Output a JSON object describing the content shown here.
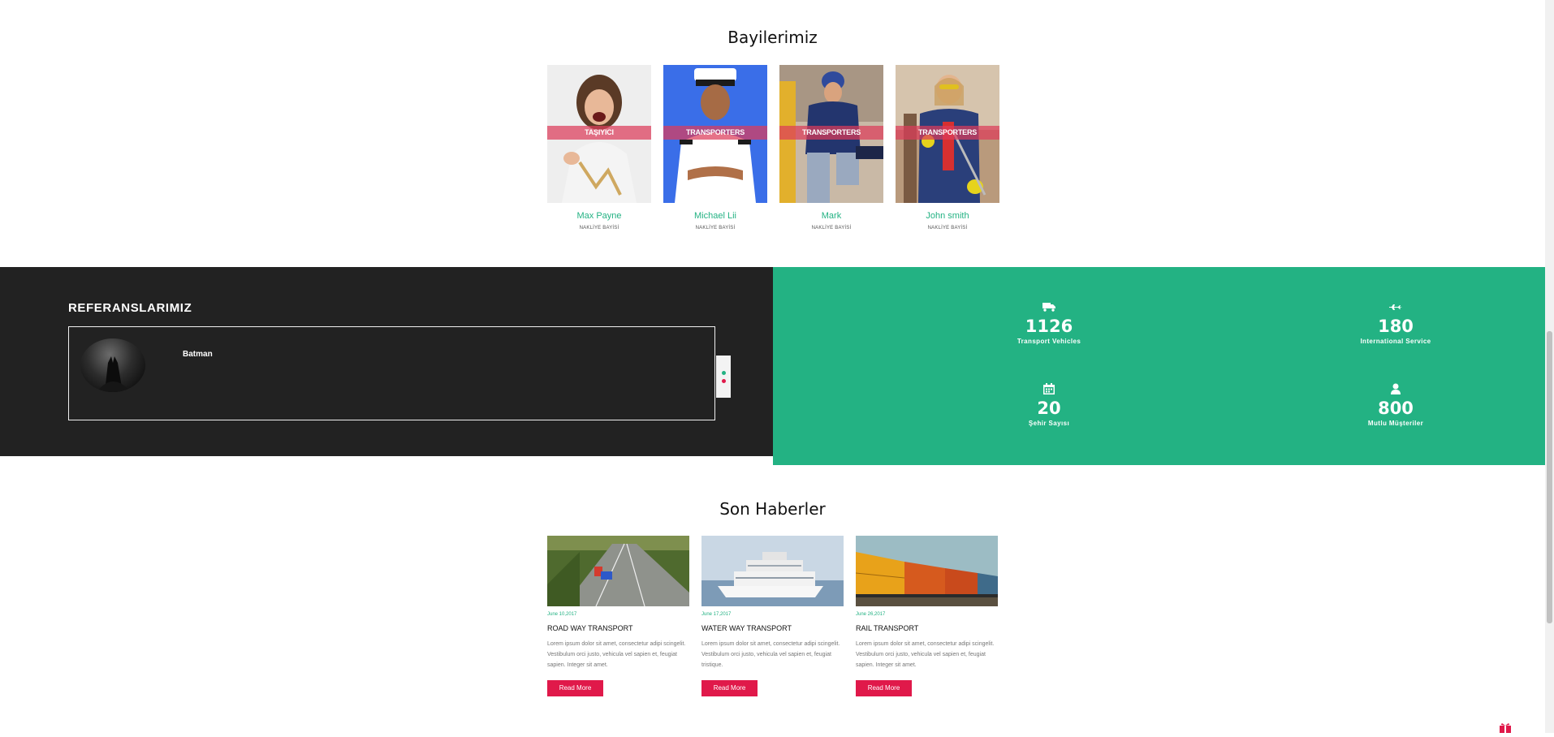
{
  "dealers_section": {
    "title": "Bayilerimiz",
    "items": [
      {
        "badge": "TAŞIYICI",
        "name": "Max Payne",
        "role": "NAKLİYE BAYİSİ"
      },
      {
        "badge": "TRANSPORTERS",
        "name": "Michael Lii",
        "role": "NAKLİYE BAYİSİ"
      },
      {
        "badge": "TRANSPORTERS",
        "name": "Mark",
        "role": "NAKLİYE BAYİSİ"
      },
      {
        "badge": "TRANSPORTERS",
        "name": "John smith",
        "role": "NAKLİYE BAYİSİ"
      }
    ]
  },
  "references": {
    "title": "REFERANSLARIMIZ",
    "items": [
      {
        "name": "Batman"
      }
    ]
  },
  "stats": [
    {
      "icon": "truck-icon",
      "value": "1126",
      "label": "Transport Vehicles"
    },
    {
      "icon": "plane-icon",
      "value": "180",
      "label": "International Service"
    },
    {
      "icon": "calendar-icon",
      "value": "20",
      "label": "Şehir Sayısı"
    },
    {
      "icon": "user-icon",
      "value": "800",
      "label": "Mutlu Müşteriler"
    }
  ],
  "news_section": {
    "title": "Son Haberler",
    "posts": [
      {
        "date": "June 10,2017",
        "title": "ROAD WAY TRANSPORT",
        "excerpt": "Lorem ipsum dolor sit amet, consectetur adipi scingelit. Vestibulum orci justo, vehicula vel sapien et, feugiat sapien. Integer sit amet.",
        "button": "Read More"
      },
      {
        "date": "June 17,2017",
        "title": "WATER WAY TRANSPORT",
        "excerpt": "Lorem ipsum dolor sit amet, consectetur adipi scingelit. Vestibulum orci justo, vehicula vel sapien et, feugiat tristique.",
        "button": "Read More"
      },
      {
        "date": "June 26,2017",
        "title": "RAIL TRANSPORT",
        "excerpt": "Lorem ipsum dolor sit amet, consectetur adipi scingelit. Vestibulum orci justo, vehicula vel sapien et, feugiat sapien. Integer sit amet.",
        "button": "Read More"
      }
    ]
  },
  "colors": {
    "accent_green": "#23b283",
    "accent_red": "#e0194a",
    "dark_bg": "#222222"
  }
}
